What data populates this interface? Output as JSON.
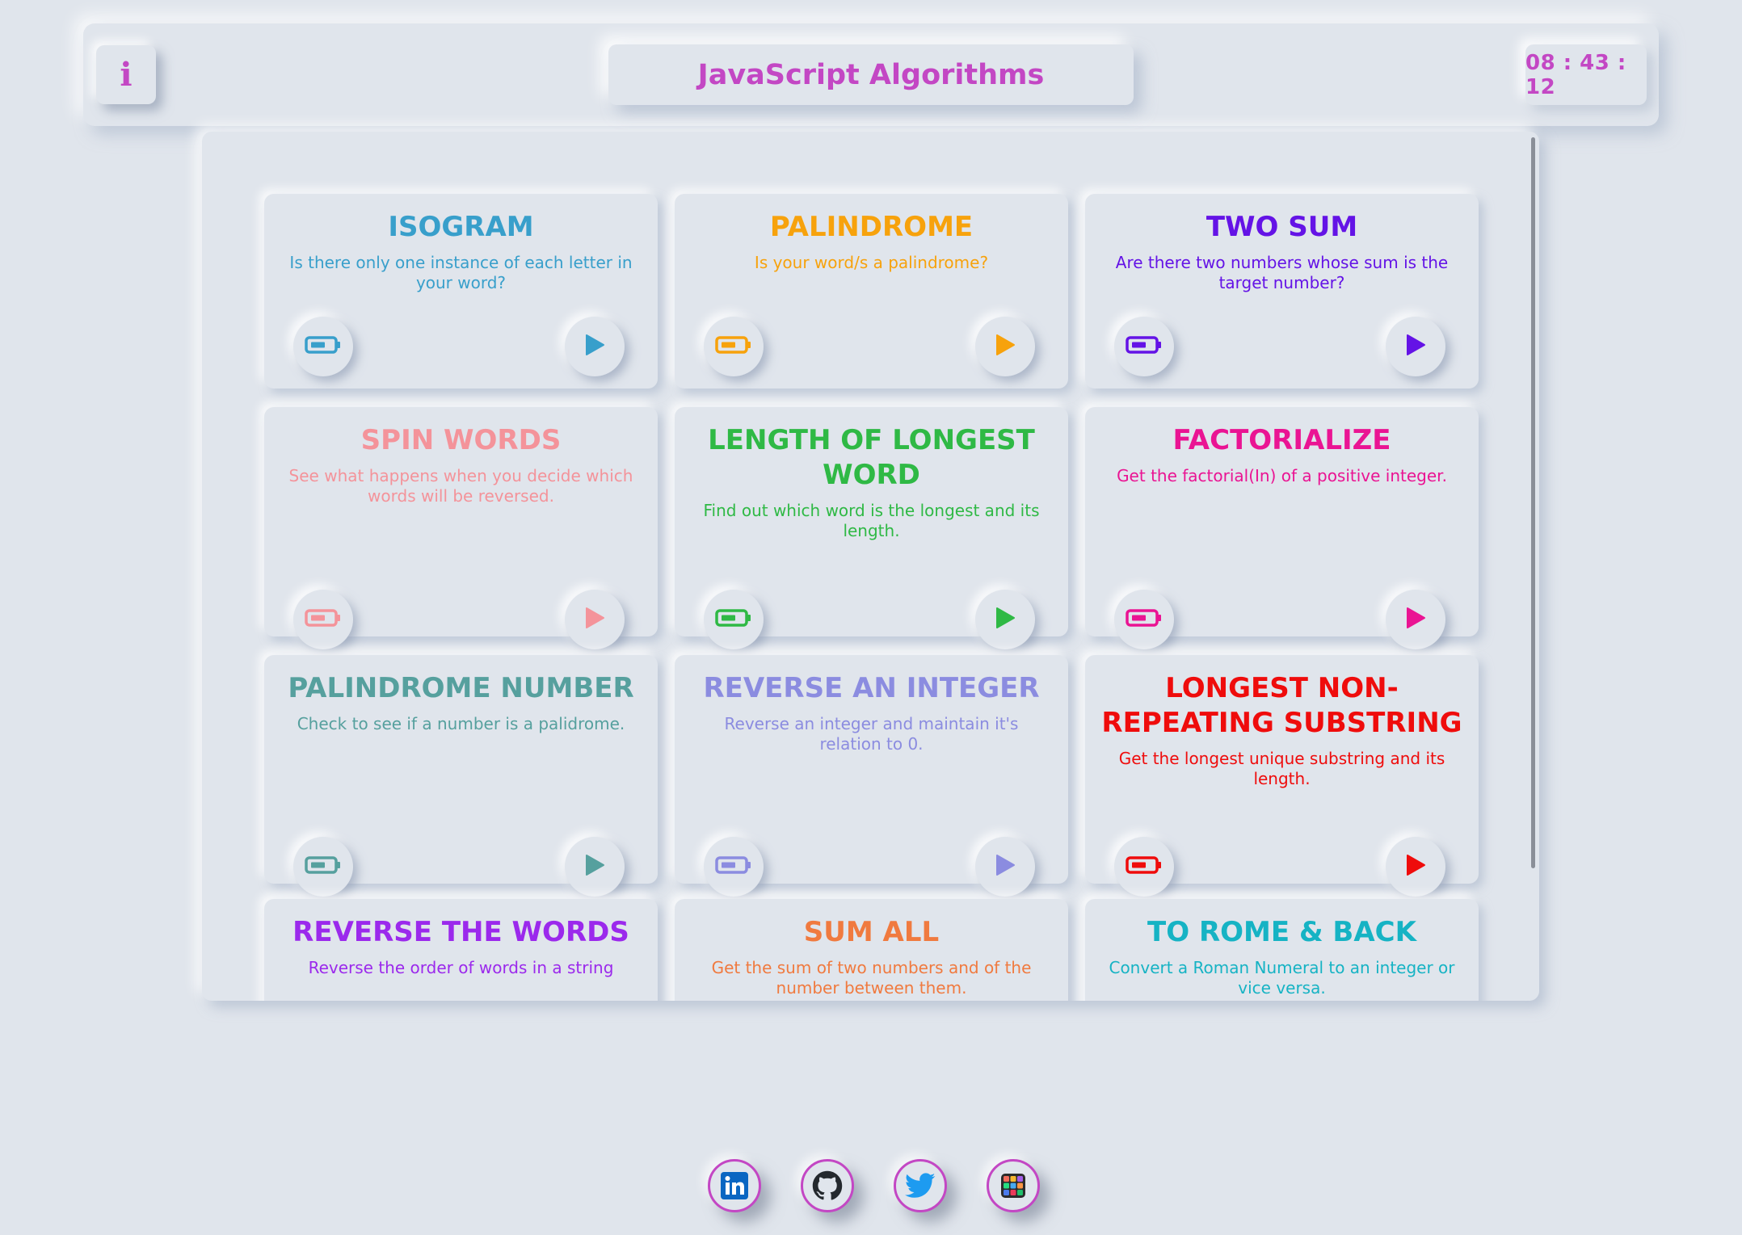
{
  "header": {
    "info_glyph": "i",
    "title": "JavaScript Algorithms",
    "clock": "08 : 43 : 12",
    "accent_color": "#c347c4"
  },
  "cards": [
    {
      "title": "ISOGRAM",
      "desc": "Is there only one instance of each letter in your word?",
      "color": "#389fcb"
    },
    {
      "title": "PALINDROME",
      "desc": "Is your word/s a palindrome?",
      "color": "#f7a20c"
    },
    {
      "title": "TWO SUM",
      "desc": "Are there two numbers whose sum is the target number?",
      "color": "#6413e6"
    },
    {
      "title": "SPIN WORDS",
      "desc": "See what happens when you decide which words will be reversed.",
      "color": "#f4939a"
    },
    {
      "title": "LENGTH OF LONGEST WORD",
      "desc": "Find out which word is the longest and its length.",
      "color": "#2fb945"
    },
    {
      "title": "FACTORIALIZE",
      "desc": "Get the factorial(In) of a positive integer.",
      "color": "#ea1493"
    },
    {
      "title": "PALINDROME NUMBER",
      "desc": "Check to see if a number is a palidrome.",
      "color": "#56a09e"
    },
    {
      "title": "REVERSE AN INTEGER",
      "desc": "Reverse an integer and maintain it's relation to 0.",
      "color": "#8b8ce0"
    },
    {
      "title": "LONGEST NON-REPEATING SUBSTRING",
      "desc": "Get the longest unique substring and its length.",
      "color": "#ef0c0c"
    },
    {
      "title": "REVERSE THE WORDS",
      "desc": "Reverse the order of words in a string",
      "color": "#9b29ec"
    },
    {
      "title": "SUM ALL",
      "desc": "Get the sum of two numbers and of the number between them.",
      "color": "#f07a3f"
    },
    {
      "title": "TO ROME & BACK",
      "desc": "Convert a Roman Numeral to an integer or vice versa.",
      "color": "#16b3c4"
    }
  ],
  "card_buttons": {
    "left_icon": "battery-icon",
    "right_icon": "play-icon"
  },
  "socials": [
    {
      "name": "linkedin-icon",
      "color": "#0a66c2"
    },
    {
      "name": "github-icon",
      "color": "#24292e"
    },
    {
      "name": "twitter-icon",
      "color": "#1d9bf0"
    },
    {
      "name": "portfolio-icon",
      "color": "#c347c4"
    }
  ]
}
